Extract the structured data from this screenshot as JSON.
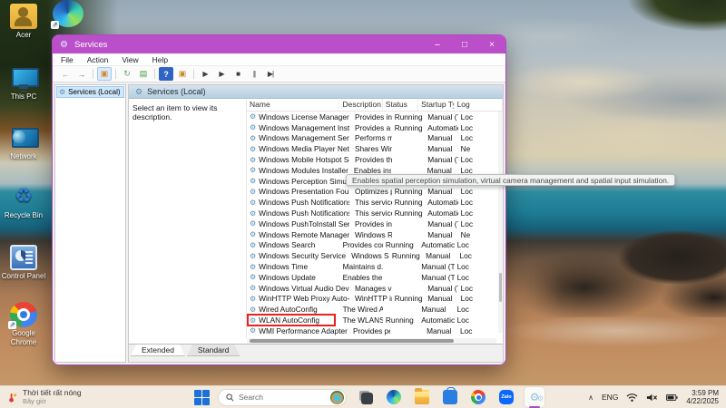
{
  "colors": {
    "titlebar": "#bb4fca",
    "window_border": "#ad49bd",
    "highlight_red": "#e8221c",
    "selection_blue": "#cde6fa",
    "taskbar_bg": "#f4ede3",
    "accent_taskbar_indicator": "#a84ec0"
  },
  "desktop": {
    "icons": [
      {
        "id": "user-folder",
        "label": "Acer"
      },
      {
        "id": "edge-shortcut",
        "label": ""
      },
      {
        "id": "this-pc",
        "label": "This PC"
      },
      {
        "id": "network",
        "label": "Network"
      },
      {
        "id": "recycle-bin",
        "label": "Recycle Bin",
        "glyph": "♻"
      },
      {
        "id": "control-panel",
        "label": "Control Panel"
      },
      {
        "id": "chrome-shortcut",
        "label": "Google Chrome"
      }
    ]
  },
  "window": {
    "title": "Services",
    "title_icon": "⚙",
    "controls": [
      {
        "name": "minimize-button",
        "glyph": "–"
      },
      {
        "name": "maximize-button",
        "glyph": "□"
      },
      {
        "name": "close-button",
        "glyph": "×"
      }
    ],
    "menu": [
      "File",
      "Action",
      "View",
      "Help"
    ],
    "toolbar": [
      {
        "name": "back-button",
        "glyph": "←",
        "cls": "tb-arrow"
      },
      {
        "name": "forward-button",
        "glyph": "→",
        "cls": "tb-arrow-green"
      },
      {
        "name": "show-hide-console-tree-button",
        "glyph": "▣",
        "cls": "tb-win"
      },
      {
        "name": "refresh-button",
        "glyph": "↻",
        "cls": "tb-doc"
      },
      {
        "name": "export-list-button",
        "glyph": "▤",
        "cls": "tb-doc-green"
      },
      {
        "name": "help-button",
        "glyph": "?",
        "cls": "tb-help"
      },
      {
        "name": "show-hide-action-pane-button",
        "glyph": "▣",
        "cls": "tb-win2"
      },
      {
        "name": "start-service-button",
        "glyph": "▶",
        "cls": "tb-play"
      },
      {
        "name": "resume-service-button",
        "glyph": "▶",
        "cls": "tb-play"
      },
      {
        "name": "stop-service-button",
        "glyph": "■",
        "cls": "tb-stop"
      },
      {
        "name": "pause-service-button",
        "glyph": "||",
        "cls": "tb-pause"
      },
      {
        "name": "restart-service-button",
        "glyph": "▶|",
        "cls": "tb-restart"
      }
    ],
    "tree": {
      "root": "Services (Local)"
    },
    "main": {
      "header": "Services (Local)",
      "description_panel": "Select an item to view its description.",
      "columns": [
        "Name",
        "Description",
        "Status",
        "Startup Type",
        "Log"
      ],
      "rows": [
        {
          "name": "Windows License Manager S...",
          "desc": "Provides infr...",
          "status": "Running",
          "startup": "Manual (Trigg...",
          "log": "Loc"
        },
        {
          "name": "Windows Management Instr...",
          "desc": "Provides a c...",
          "status": "Running",
          "startup": "Automatic",
          "log": "Loc"
        },
        {
          "name": "Windows Management Serv...",
          "desc": "Performs ma...",
          "status": "",
          "startup": "Manual",
          "log": "Loc"
        },
        {
          "name": "Windows Media Player Netw...",
          "desc": "Shares Wind...",
          "status": "",
          "startup": "Manual",
          "log": "Ne"
        },
        {
          "name": "Windows Mobile Hotspot Se...",
          "desc": "Provides the...",
          "status": "",
          "startup": "Manual (Trigg...",
          "log": "Loc"
        },
        {
          "name": "Windows Modules Installer",
          "desc": "Enables inst...",
          "status": "",
          "startup": "Manual",
          "log": "Loc"
        },
        {
          "name": "Windows Perception Simulat...",
          "desc": "",
          "status": "",
          "startup": "",
          "log": ""
        },
        {
          "name": "Windows Presentation Foun...",
          "desc": "Optimizes p...",
          "status": "Running",
          "startup": "Manual",
          "log": "Loc"
        },
        {
          "name": "Windows Push Notifications...",
          "desc": "This service r...",
          "status": "Running",
          "startup": "Automatic",
          "log": "Loc"
        },
        {
          "name": "Windows Push Notifications...",
          "desc": "This service ...",
          "status": "Running",
          "startup": "Automatic",
          "log": "Loc"
        },
        {
          "name": "Windows PushToInstall Servi...",
          "desc": "Provides infr...",
          "status": "",
          "startup": "Manual (Trigg...",
          "log": "Loc"
        },
        {
          "name": "Windows Remote Managem...",
          "desc": "Windows Re...",
          "status": "",
          "startup": "Manual",
          "log": "Ne"
        },
        {
          "name": "Windows Search",
          "desc": "Provides con...",
          "status": "Running",
          "startup": "Automatic (De...",
          "log": "Loc"
        },
        {
          "name": "Windows Security Service",
          "desc": "Windows Se...",
          "status": "Running",
          "startup": "Manual",
          "log": "Loc"
        },
        {
          "name": "Windows Time",
          "desc": "Maintains d...",
          "status": "",
          "startup": "Manual (Trigg...",
          "log": "Loc"
        },
        {
          "name": "Windows Update",
          "desc": "Enables the ...",
          "status": "",
          "startup": "Manual (Trigg...",
          "log": "Loc"
        },
        {
          "name": "Windows Virtual Audio Devi...",
          "desc": "Manages vir...",
          "status": "",
          "startup": "Manual (Trigg...",
          "log": "Loc"
        },
        {
          "name": "WinHTTP Web Proxy Auto-D...",
          "desc": "WinHTTP im...",
          "status": "Running",
          "startup": "Manual",
          "log": "Loc"
        },
        {
          "name": "Wired AutoConfig",
          "desc": "The Wired A...",
          "status": "",
          "startup": "Manual",
          "log": "Loc"
        },
        {
          "name": "WLAN AutoConfig",
          "desc": "The WLANS...",
          "status": "Running",
          "startup": "Automatic",
          "log": "Loc",
          "highlighted": true
        },
        {
          "name": "WMI Performance Adapter",
          "desc": "Provides per...",
          "status": "",
          "startup": "Manual",
          "log": "Loc"
        }
      ]
    },
    "tabs": [
      {
        "label": "Extended",
        "active": true
      },
      {
        "label": "Standard",
        "active": false
      }
    ],
    "tooltip": "Enables spatial perception simulation, virtual camera management and spatial input simulation."
  },
  "taskbar": {
    "weather": {
      "line1": "Thời tiết rất nóng",
      "line2": "Bây giờ"
    },
    "search": {
      "placeholder": "Search"
    },
    "apps": [
      {
        "id": "task-view",
        "label": ""
      },
      {
        "id": "edge",
        "label": ""
      },
      {
        "id": "explorer",
        "label": ""
      },
      {
        "id": "store",
        "label": ""
      },
      {
        "id": "chrome",
        "label": ""
      },
      {
        "id": "zalo",
        "label": "Zalo"
      },
      {
        "id": "services",
        "label": "",
        "active": true
      }
    ],
    "tray": {
      "chevron": "∧",
      "language": "ENG",
      "time": "3:59 PM",
      "date": "4/22/2025"
    }
  }
}
